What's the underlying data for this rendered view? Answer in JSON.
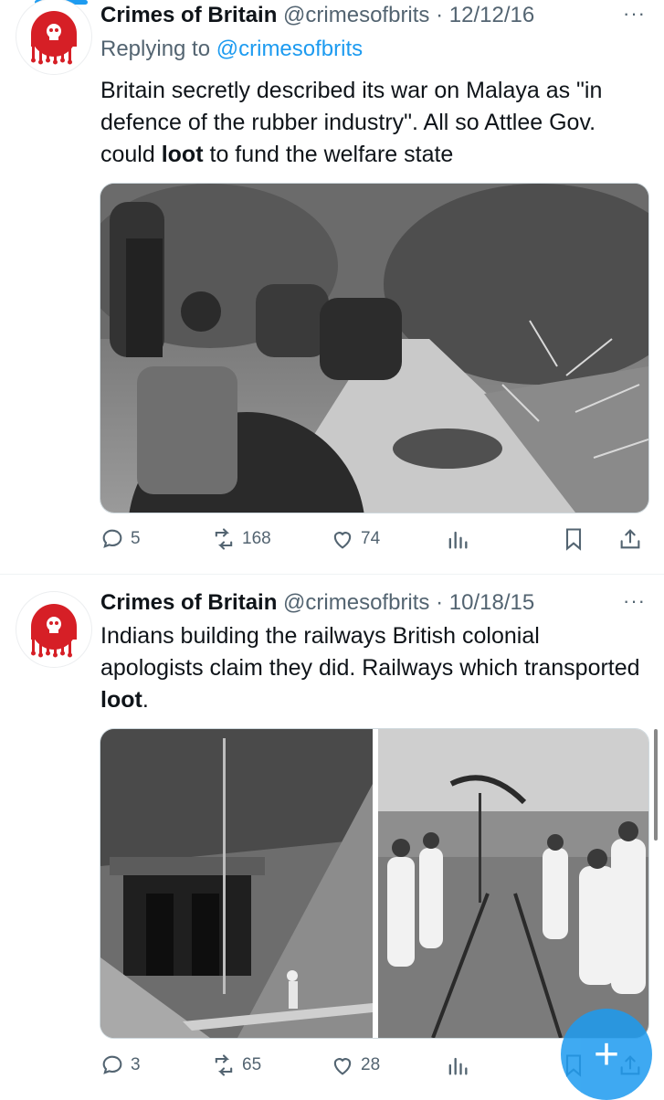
{
  "tweets": [
    {
      "name": "Crimes of Britain",
      "handle": "@crimesofbrits",
      "sep": "·",
      "date": "12/12/16",
      "replying_prefix": "Replying to",
      "replying_to": "@crimesofbrits",
      "text_before": "Britain secretly described its war on Malaya as \"in defence of the rubber industry\". All so Attlee Gov. could ",
      "text_bold": "loot",
      "text_after": " to fund the welfare state",
      "counts": {
        "replies": "5",
        "retweets": "168",
        "likes": "74"
      }
    },
    {
      "name": "Crimes of Britain",
      "handle": "@crimesofbrits",
      "sep": "·",
      "date": "10/18/15",
      "text_before": "Indians building the railways British colonial apologists claim they did. Railways which transported ",
      "text_bold": "loot",
      "text_after": ".",
      "counts": {
        "replies": "3",
        "retweets": "65",
        "likes": "28"
      }
    }
  ],
  "more_glyph": "···",
  "fab_glyph": "+",
  "icons": [
    "reply-icon",
    "retweet-icon",
    "like-icon",
    "analytics-icon",
    "bookmark-icon",
    "share-icon",
    "skull-avatar-icon"
  ],
  "colors": {
    "accent": "#1d9bf0",
    "muted": "#536471",
    "text": "#0f1419",
    "avatar_red": "#d61f26"
  }
}
